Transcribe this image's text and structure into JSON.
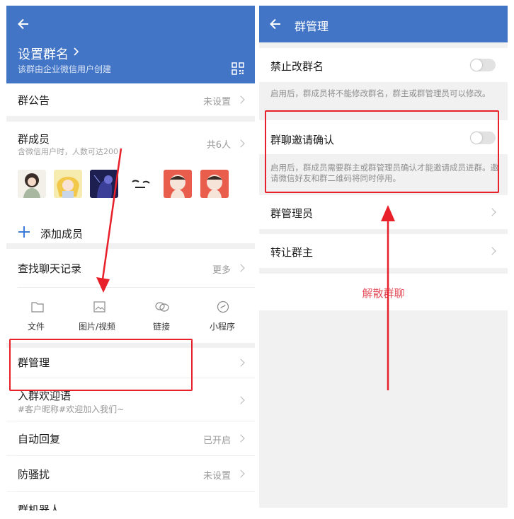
{
  "left": {
    "header": {
      "title": "设置群名",
      "subtitle": "该群由企业微信用户创建"
    },
    "announcement": {
      "label": "群公告",
      "value": "未设置"
    },
    "members": {
      "label": "群成员",
      "hint": "含微信用户时，人数可达200",
      "count": "共6人",
      "add_label": "添加成员"
    },
    "chat_history": {
      "label": "查找聊天记录",
      "more": "更多"
    },
    "history_tabs": [
      {
        "label": "文件",
        "icon": "folder-icon"
      },
      {
        "label": "图片/视频",
        "icon": "image-icon"
      },
      {
        "label": "链接",
        "icon": "link-icon"
      },
      {
        "label": "小程序",
        "icon": "mini-program-icon"
      }
    ],
    "group_manage": {
      "label": "群管理"
    },
    "welcome": {
      "label": "入群欢迎语",
      "value": "#客户昵称#欢迎加入我们~"
    },
    "auto_reply": {
      "label": "自动回复",
      "value": "已开启"
    },
    "anti_harass": {
      "label": "防骚扰",
      "value": "未设置"
    },
    "group_bot": {
      "label": "群机器人"
    }
  },
  "right": {
    "header": {
      "title": "群管理"
    },
    "forbid_rename": {
      "label": "禁止改群名",
      "enabled": false,
      "desc": "启用后，群成员将不能修改群名，群主或群管理员可以修改。"
    },
    "invite_confirm": {
      "label": "群聊邀请确认",
      "enabled": false,
      "desc": "启用后，群成员需要群主或群管理员确认才能邀请成员进群。邀请微信好友和群二维码将同时停用。"
    },
    "admins": {
      "label": "群管理员"
    },
    "transfer_owner": {
      "label": "转让群主"
    },
    "dissolve": {
      "label": "解散群聊"
    }
  },
  "colors": {
    "header_blue": "#4275c6",
    "highlight_red": "#e8202a",
    "dissolve_red": "#e34d59",
    "add_plus_blue": "#3d7bd8"
  }
}
